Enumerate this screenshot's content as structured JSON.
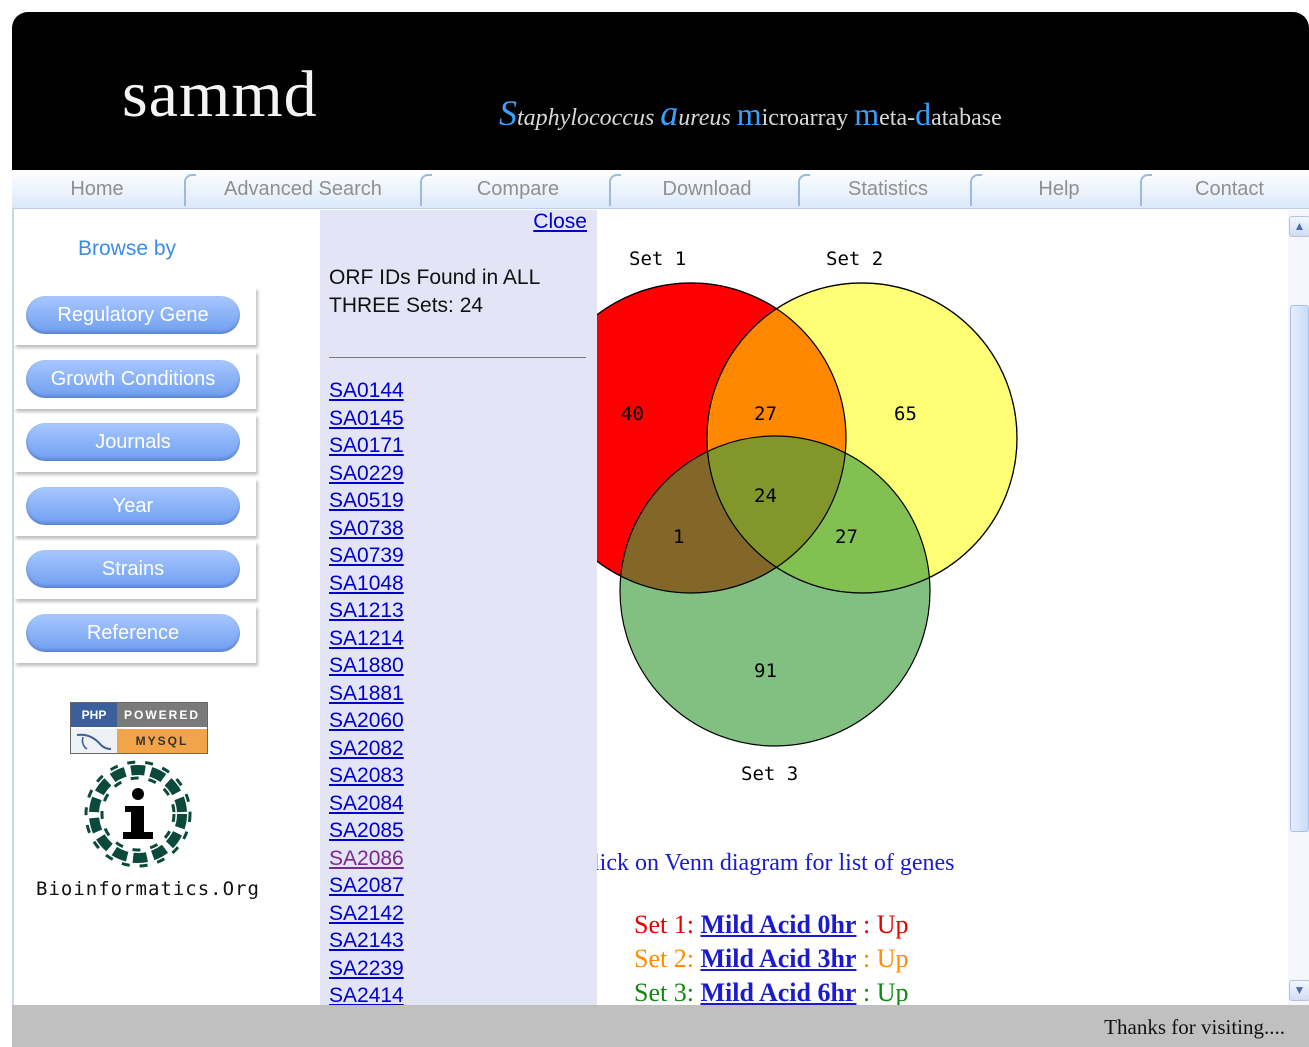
{
  "header": {
    "logo": "sammd",
    "tagline": {
      "s_cap": "S",
      "s_rest": "taphylococcus ",
      "a_cap": "a",
      "a_rest": "ureus ",
      "m1_cap": "m",
      "m1_rest": "icroarray ",
      "m2_cap": "m",
      "m2_rest": "eta-",
      "d_cap": "d",
      "d_rest": "atabase"
    }
  },
  "nav": {
    "tabs": [
      "Home",
      "Advanced Search",
      "Compare",
      "Download",
      "Statistics",
      "Help",
      "Contact"
    ]
  },
  "sidebar": {
    "browse_label": "Browse by",
    "buttons": [
      "Regulatory Gene",
      "Growth Conditions",
      "Journals",
      "Year",
      "Strains",
      "Reference"
    ],
    "badge": {
      "php": "PHP",
      "powered": "POWERED",
      "mysql": "MYSQL"
    },
    "bio_text": "Bioinformatics.Org"
  },
  "panel": {
    "close_label": "Close",
    "found_text": "ORF IDs Found in ALL THREE Sets: 24",
    "orfs": [
      "SA0144",
      "SA0145",
      "SA0171",
      "SA0229",
      "SA0519",
      "SA0738",
      "SA0739",
      "SA1048",
      "SA1213",
      "SA1214",
      "SA1880",
      "SA1881",
      "SA2060",
      "SA2082",
      "SA2083",
      "SA2084",
      "SA2085",
      "SA2086",
      "SA2087",
      "SA2142",
      "SA2143",
      "SA2239",
      "SA2414"
    ],
    "visited_orf": "SA2086"
  },
  "venn": {
    "set1_label": "Set 1",
    "set2_label": "Set 2",
    "set3_label": "Set 3",
    "only1": "40",
    "set1_2": "27",
    "only2": "65",
    "all3": "24",
    "set1_3": "1",
    "set2_3": "27",
    "only3": "91",
    "colors": {
      "set1": "#ff0000",
      "set2": "#ffff66",
      "set3": "#6bbf6b"
    }
  },
  "caption": "Click on Venn diagram for list of genes",
  "sets": [
    {
      "prefix": "Set 1: ",
      "name": "Mild Acid 0hr",
      "sep": " : ",
      "dir": "Up",
      "color": "#e80000"
    },
    {
      "prefix": "Set 2: ",
      "name": "Mild Acid 3hr",
      "sep": " : ",
      "dir": "Up",
      "color": "#ff8c00"
    },
    {
      "prefix": "Set 3: ",
      "name": "Mild Acid 6hr",
      "sep": " : ",
      "dir": "Up",
      "color": "#118811"
    }
  ],
  "footer": {
    "thanks": "Thanks for visiting...."
  }
}
